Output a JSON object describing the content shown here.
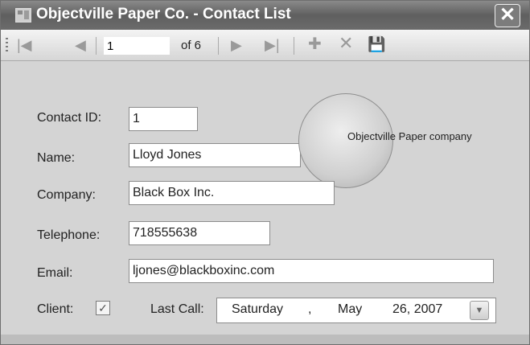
{
  "window": {
    "title": "Objectville Paper Co. - Contact List",
    "close_glyph": "✕"
  },
  "navigator": {
    "move_first_icon": "|◀",
    "move_previous_icon": "◀",
    "position_value": "1",
    "count_label": "of 6",
    "move_next_icon": "▶",
    "move_last_icon": "▶|",
    "add_new_icon": "✚",
    "delete_icon": "✕",
    "save_icon": "💾"
  },
  "form": {
    "contact_id": {
      "label": "Contact ID:",
      "value": "1"
    },
    "name": {
      "label": "Name:",
      "value": "Lloyd Jones"
    },
    "company": {
      "label": "Company:",
      "value": "Black Box Inc."
    },
    "telephone": {
      "label": "Telephone:",
      "value": "718555638"
    },
    "email": {
      "label": "Email:",
      "value": "ljones@blackboxinc.com"
    },
    "client": {
      "label": "Client:",
      "checked": true,
      "check_glyph": "✓"
    },
    "last_call": {
      "label": "Last Call:",
      "day_of_week": "Saturday",
      "separator": ",",
      "month": "May",
      "day_year": "26, 2007",
      "dropdown_glyph": "▼"
    }
  },
  "logo": {
    "text": "Objectville Paper company"
  },
  "colors": {
    "titlebar": "#6b6b6b",
    "form_background": "#d4d4d4",
    "toolbar": "#e4e4e4"
  }
}
